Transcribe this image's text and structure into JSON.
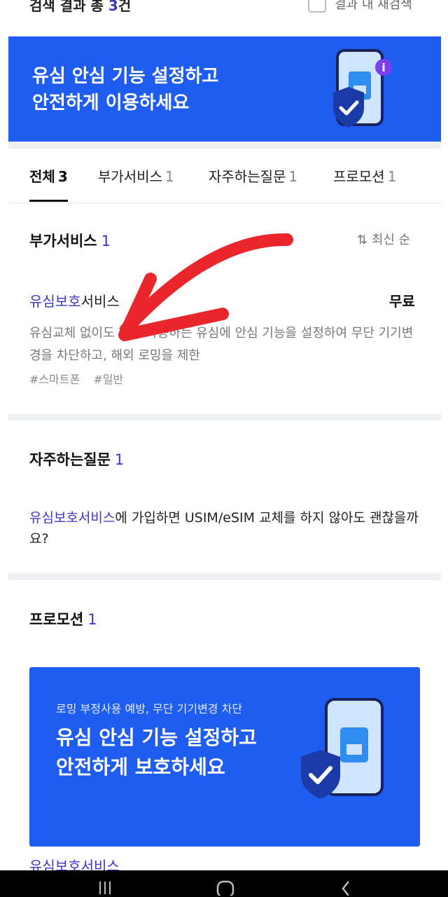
{
  "top": {
    "result_prefix": "검색 결과 총",
    "result_count": "3",
    "result_suffix": "건",
    "checkbox_label": "결과 내 재검색"
  },
  "banner_top": {
    "title": "유심 안심 기능 설정하고\n안전하게 이용하세요"
  },
  "tabs": [
    {
      "label": "전체",
      "count": "3",
      "active": true
    },
    {
      "label": "부가서비스",
      "count": "1",
      "active": false
    },
    {
      "label": "자주하는질문",
      "count": "1",
      "active": false
    },
    {
      "label": "프로모션",
      "count": "1",
      "active": false
    }
  ],
  "addon_section": {
    "title": "부가서비스",
    "count": "1",
    "sort_label": "최신 순",
    "item": {
      "title_highlight": "유심보호",
      "title_rest": "서비스",
      "price": "무료",
      "description": "유심교체 없이도 현재 사용하는 유심에 안심 기능을 설정하여 무단 기기변경을 차단하고, 해외 로밍을 제한",
      "tags": [
        "#스마트폰",
        "#일반"
      ]
    }
  },
  "faq_section": {
    "title": "자주하는질문",
    "count": "1",
    "question_highlight": "유심보호서비스",
    "question_rest": "에 가입하면 USIM/eSIM 교체를 하지 않아도 괜찮을까요?"
  },
  "promo_section": {
    "title": "프로모션",
    "count": "1",
    "banner_subtitle": "로밍 부정사용 예방, 무단 기기변경 차단",
    "banner_title": "유심 안심 기능 설정하고\n안전하게 보호하세요",
    "next_item_cut": "유심보호서비스"
  },
  "colors": {
    "brand_blue": "#1f5df0",
    "accent_purple": "#3b35c9",
    "arrow_red": "#e8262b"
  },
  "icons": [
    "phone-sim-icon",
    "shield-check-icon",
    "info-badge-icon",
    "sort-arrows-icon",
    "recent-apps-icon",
    "home-icon",
    "back-icon"
  ]
}
